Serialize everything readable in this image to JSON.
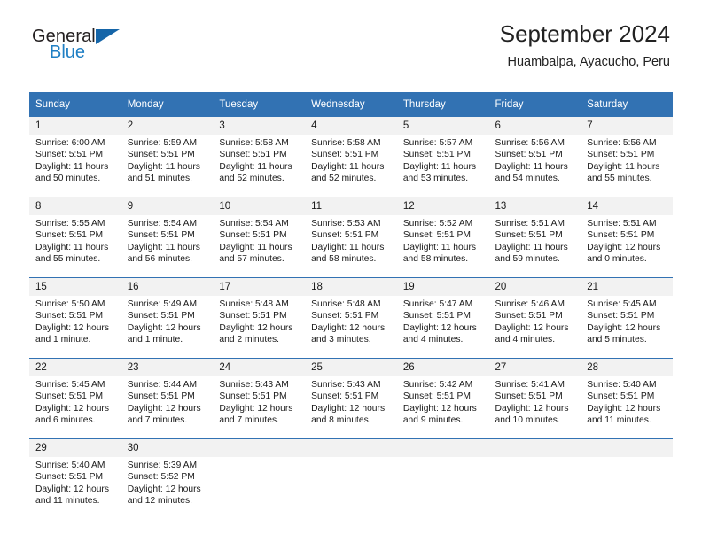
{
  "brand": {
    "name_part1": "General",
    "name_part2": "Blue",
    "accent_color": "#1f7fc4",
    "triangle_color": "#1565a8"
  },
  "header": {
    "title": "September 2024",
    "subtitle": "Huambalpa, Ayacucho, Peru",
    "header_bg_color": "#3272b3",
    "daynum_bg_color": "#f2f2f2"
  },
  "weekday_headers": [
    "Sunday",
    "Monday",
    "Tuesday",
    "Wednesday",
    "Thursday",
    "Friday",
    "Saturday"
  ],
  "weeks": [
    {
      "numbers": [
        "1",
        "2",
        "3",
        "4",
        "5",
        "6",
        "7"
      ],
      "cells": [
        {
          "sunrise": "Sunrise: 6:00 AM",
          "sunset": "Sunset: 5:51 PM",
          "daylight1": "Daylight: 11 hours",
          "daylight2": "and 50 minutes."
        },
        {
          "sunrise": "Sunrise: 5:59 AM",
          "sunset": "Sunset: 5:51 PM",
          "daylight1": "Daylight: 11 hours",
          "daylight2": "and 51 minutes."
        },
        {
          "sunrise": "Sunrise: 5:58 AM",
          "sunset": "Sunset: 5:51 PM",
          "daylight1": "Daylight: 11 hours",
          "daylight2": "and 52 minutes."
        },
        {
          "sunrise": "Sunrise: 5:58 AM",
          "sunset": "Sunset: 5:51 PM",
          "daylight1": "Daylight: 11 hours",
          "daylight2": "and 52 minutes."
        },
        {
          "sunrise": "Sunrise: 5:57 AM",
          "sunset": "Sunset: 5:51 PM",
          "daylight1": "Daylight: 11 hours",
          "daylight2": "and 53 minutes."
        },
        {
          "sunrise": "Sunrise: 5:56 AM",
          "sunset": "Sunset: 5:51 PM",
          "daylight1": "Daylight: 11 hours",
          "daylight2": "and 54 minutes."
        },
        {
          "sunrise": "Sunrise: 5:56 AM",
          "sunset": "Sunset: 5:51 PM",
          "daylight1": "Daylight: 11 hours",
          "daylight2": "and 55 minutes."
        }
      ]
    },
    {
      "numbers": [
        "8",
        "9",
        "10",
        "11",
        "12",
        "13",
        "14"
      ],
      "cells": [
        {
          "sunrise": "Sunrise: 5:55 AM",
          "sunset": "Sunset: 5:51 PM",
          "daylight1": "Daylight: 11 hours",
          "daylight2": "and 55 minutes."
        },
        {
          "sunrise": "Sunrise: 5:54 AM",
          "sunset": "Sunset: 5:51 PM",
          "daylight1": "Daylight: 11 hours",
          "daylight2": "and 56 minutes."
        },
        {
          "sunrise": "Sunrise: 5:54 AM",
          "sunset": "Sunset: 5:51 PM",
          "daylight1": "Daylight: 11 hours",
          "daylight2": "and 57 minutes."
        },
        {
          "sunrise": "Sunrise: 5:53 AM",
          "sunset": "Sunset: 5:51 PM",
          "daylight1": "Daylight: 11 hours",
          "daylight2": "and 58 minutes."
        },
        {
          "sunrise": "Sunrise: 5:52 AM",
          "sunset": "Sunset: 5:51 PM",
          "daylight1": "Daylight: 11 hours",
          "daylight2": "and 58 minutes."
        },
        {
          "sunrise": "Sunrise: 5:51 AM",
          "sunset": "Sunset: 5:51 PM",
          "daylight1": "Daylight: 11 hours",
          "daylight2": "and 59 minutes."
        },
        {
          "sunrise": "Sunrise: 5:51 AM",
          "sunset": "Sunset: 5:51 PM",
          "daylight1": "Daylight: 12 hours",
          "daylight2": "and 0 minutes."
        }
      ]
    },
    {
      "numbers": [
        "15",
        "16",
        "17",
        "18",
        "19",
        "20",
        "21"
      ],
      "cells": [
        {
          "sunrise": "Sunrise: 5:50 AM",
          "sunset": "Sunset: 5:51 PM",
          "daylight1": "Daylight: 12 hours",
          "daylight2": "and 1 minute."
        },
        {
          "sunrise": "Sunrise: 5:49 AM",
          "sunset": "Sunset: 5:51 PM",
          "daylight1": "Daylight: 12 hours",
          "daylight2": "and 1 minute."
        },
        {
          "sunrise": "Sunrise: 5:48 AM",
          "sunset": "Sunset: 5:51 PM",
          "daylight1": "Daylight: 12 hours",
          "daylight2": "and 2 minutes."
        },
        {
          "sunrise": "Sunrise: 5:48 AM",
          "sunset": "Sunset: 5:51 PM",
          "daylight1": "Daylight: 12 hours",
          "daylight2": "and 3 minutes."
        },
        {
          "sunrise": "Sunrise: 5:47 AM",
          "sunset": "Sunset: 5:51 PM",
          "daylight1": "Daylight: 12 hours",
          "daylight2": "and 4 minutes."
        },
        {
          "sunrise": "Sunrise: 5:46 AM",
          "sunset": "Sunset: 5:51 PM",
          "daylight1": "Daylight: 12 hours",
          "daylight2": "and 4 minutes."
        },
        {
          "sunrise": "Sunrise: 5:45 AM",
          "sunset": "Sunset: 5:51 PM",
          "daylight1": "Daylight: 12 hours",
          "daylight2": "and 5 minutes."
        }
      ]
    },
    {
      "numbers": [
        "22",
        "23",
        "24",
        "25",
        "26",
        "27",
        "28"
      ],
      "cells": [
        {
          "sunrise": "Sunrise: 5:45 AM",
          "sunset": "Sunset: 5:51 PM",
          "daylight1": "Daylight: 12 hours",
          "daylight2": "and 6 minutes."
        },
        {
          "sunrise": "Sunrise: 5:44 AM",
          "sunset": "Sunset: 5:51 PM",
          "daylight1": "Daylight: 12 hours",
          "daylight2": "and 7 minutes."
        },
        {
          "sunrise": "Sunrise: 5:43 AM",
          "sunset": "Sunset: 5:51 PM",
          "daylight1": "Daylight: 12 hours",
          "daylight2": "and 7 minutes."
        },
        {
          "sunrise": "Sunrise: 5:43 AM",
          "sunset": "Sunset: 5:51 PM",
          "daylight1": "Daylight: 12 hours",
          "daylight2": "and 8 minutes."
        },
        {
          "sunrise": "Sunrise: 5:42 AM",
          "sunset": "Sunset: 5:51 PM",
          "daylight1": "Daylight: 12 hours",
          "daylight2": "and 9 minutes."
        },
        {
          "sunrise": "Sunrise: 5:41 AM",
          "sunset": "Sunset: 5:51 PM",
          "daylight1": "Daylight: 12 hours",
          "daylight2": "and 10 minutes."
        },
        {
          "sunrise": "Sunrise: 5:40 AM",
          "sunset": "Sunset: 5:51 PM",
          "daylight1": "Daylight: 12 hours",
          "daylight2": "and 11 minutes."
        }
      ]
    },
    {
      "numbers": [
        "29",
        "30",
        "",
        "",
        "",
        "",
        ""
      ],
      "cells": [
        {
          "sunrise": "Sunrise: 5:40 AM",
          "sunset": "Sunset: 5:51 PM",
          "daylight1": "Daylight: 12 hours",
          "daylight2": "and 11 minutes."
        },
        {
          "sunrise": "Sunrise: 5:39 AM",
          "sunset": "Sunset: 5:52 PM",
          "daylight1": "Daylight: 12 hours",
          "daylight2": "and 12 minutes."
        },
        {
          "sunrise": "",
          "sunset": "",
          "daylight1": "",
          "daylight2": ""
        },
        {
          "sunrise": "",
          "sunset": "",
          "daylight1": "",
          "daylight2": ""
        },
        {
          "sunrise": "",
          "sunset": "",
          "daylight1": "",
          "daylight2": ""
        },
        {
          "sunrise": "",
          "sunset": "",
          "daylight1": "",
          "daylight2": ""
        },
        {
          "sunrise": "",
          "sunset": "",
          "daylight1": "",
          "daylight2": ""
        }
      ]
    }
  ]
}
